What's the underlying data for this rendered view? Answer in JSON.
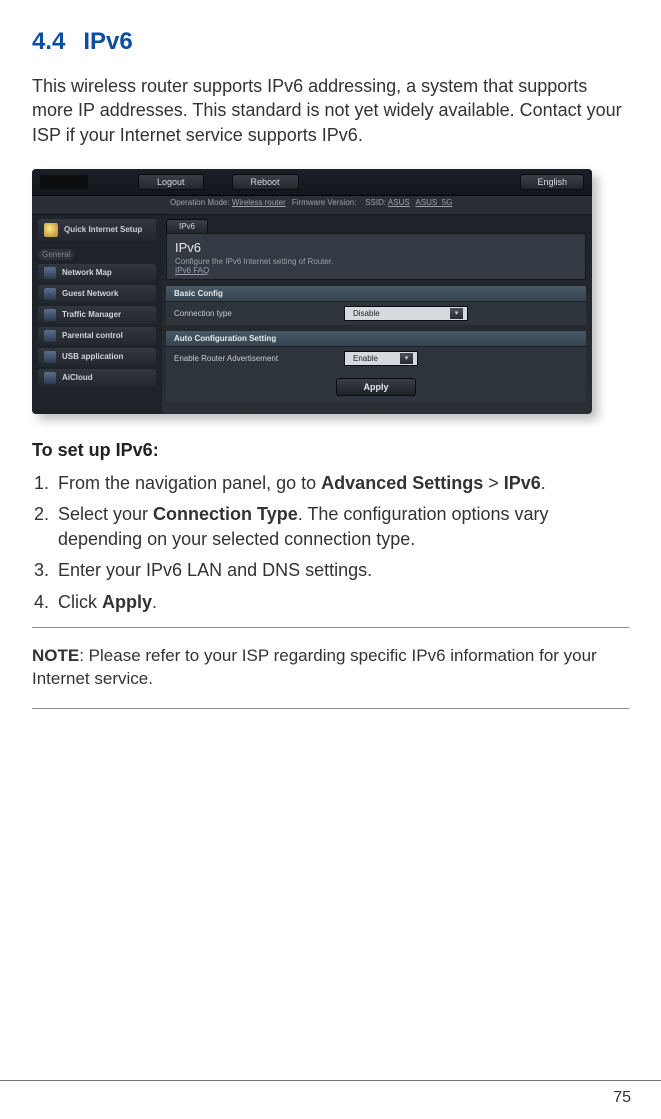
{
  "section": {
    "number": "4.4",
    "title": "IPv6"
  },
  "intro": "This wireless router supports IPv6 addressing, a system that supports more IP addresses. This standard is not yet widely available. Contact your ISP if your Internet service supports IPv6.",
  "screenshot": {
    "header": {
      "logout": "Logout",
      "reboot": "Reboot",
      "language": "English"
    },
    "statusbar": {
      "opmode_label": "Operation Mode:",
      "opmode_value": "Wireless router",
      "fw_label": "Firmware Version:",
      "ssid_label": "SSID:",
      "ssid1": "ASUS",
      "ssid2": "ASUS_5G"
    },
    "sidebar": {
      "quick_setup": "Quick Internet Setup",
      "group_general": "General",
      "items": [
        {
          "label": "Network Map"
        },
        {
          "label": "Guest Network"
        },
        {
          "label": "Traffic Manager"
        },
        {
          "label": "Parental control"
        },
        {
          "label": "USB application"
        },
        {
          "label": "AiCloud"
        }
      ]
    },
    "main": {
      "tab": "IPv6",
      "panel_title": "IPv6",
      "panel_desc": "Configure the IPv6 Internet setting of Router.",
      "faq": "IPv6 FAQ",
      "group1": "Basic Config",
      "row1_label": "Connection type",
      "row1_value": "Disable",
      "group2": "Auto Configuration Setting",
      "row2_label": "Enable Router Advertisement",
      "row2_value": "Enable",
      "apply": "Apply"
    }
  },
  "steps_heading": "To set up IPv6:",
  "steps": {
    "s1a": "From the navigation panel, go to ",
    "s1b": "Advanced Settings",
    "s1c": " > ",
    "s1d": "IPv6",
    "s1e": ".",
    "s2a": "Select your ",
    "s2b": "Connection Type",
    "s2c": ". The configuration options vary depending on your selected connection type.",
    "s3": "Enter your IPv6 LAN and DNS settings.",
    "s4a": "Click ",
    "s4b": "Apply",
    "s4c": "."
  },
  "note": {
    "label": "NOTE",
    "text": ": Please refer to your ISP regarding specific IPv6 information for your Internet service."
  },
  "page_number": "75"
}
